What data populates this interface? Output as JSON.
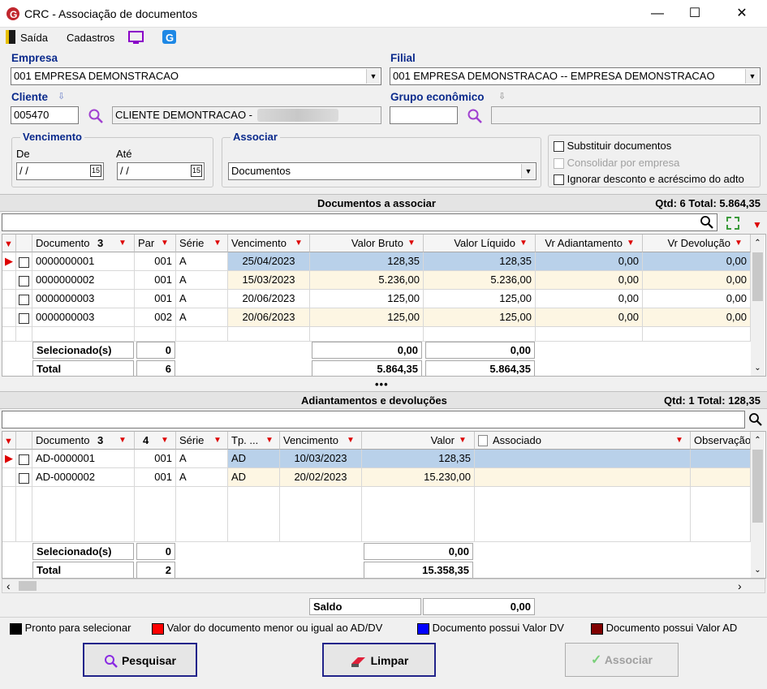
{
  "window": {
    "title": "CRC - Associação de documentos"
  },
  "menu": {
    "exit": "Saída",
    "cadastros": "Cadastros"
  },
  "form": {
    "empresa_label": "Empresa",
    "empresa_value": "001 EMPRESA DEMONSTRACAO",
    "filial_label": "Filial",
    "filial_value": "001 EMPRESA DEMONSTRACAO -- EMPRESA DEMONSTRACAO",
    "cliente_label": "Cliente",
    "cliente_code": "005470",
    "cliente_name": "CLIENTE DEMONTRACAO -",
    "grupo_label": "Grupo econômico",
    "vencimento_label": "Vencimento",
    "de_label": "De",
    "ate_label": "Até",
    "de_value": "/ /",
    "ate_value": "/ /",
    "associar_label": "Associar",
    "associar_value": "Documentos",
    "substituir": "Substituir documentos",
    "consolidar": "Consolidar por empresa",
    "ignorar": "Ignorar desconto e acréscimo do adto"
  },
  "docs": {
    "title": "Documentos a associar",
    "summary": "Qtd: 6 Total: 5.864,35",
    "columns": {
      "documento": "Documento",
      "par": "Par",
      "serie": "Série",
      "vencimento": "Vencimento",
      "valor_bruto": "Valor Bruto",
      "valor_liquido": "Valor Líquido",
      "vr_adiantamento": "Vr Adiantamento",
      "vr_devolucao": "Vr Devolução"
    },
    "sort_doc": "3",
    "rows": [
      {
        "documento": "0000000001",
        "par": "001",
        "serie": "A",
        "vencimento": "25/04/2023",
        "valor_bruto": "128,35",
        "valor_liquido": "128,35",
        "vr_adiantamento": "0,00",
        "vr_devolucao": "0,00"
      },
      {
        "documento": "0000000002",
        "par": "001",
        "serie": "A",
        "vencimento": "15/03/2023",
        "valor_bruto": "5.236,00",
        "valor_liquido": "5.236,00",
        "vr_adiantamento": "0,00",
        "vr_devolucao": "0,00"
      },
      {
        "documento": "0000000003",
        "par": "001",
        "serie": "A",
        "vencimento": "20/06/2023",
        "valor_bruto": "125,00",
        "valor_liquido": "125,00",
        "vr_adiantamento": "0,00",
        "vr_devolucao": "0,00"
      },
      {
        "documento": "0000000003",
        "par": "002",
        "serie": "A",
        "vencimento": "20/06/2023",
        "valor_bruto": "125,00",
        "valor_liquido": "125,00",
        "vr_adiantamento": "0,00",
        "vr_devolucao": "0,00"
      }
    ],
    "selecionados_label": "Selecionado(s)",
    "selecionados_qtd": "0",
    "selecionados_bruto": "0,00",
    "selecionados_liquido": "0,00",
    "total_label": "Total",
    "total_qtd": "6",
    "total_bruto": "5.864,35",
    "total_liquido": "5.864,35"
  },
  "adv": {
    "title": "Adiantamentos e devoluções",
    "summary": "Qtd: 1 Total: 128,35",
    "columns": {
      "documento": "Documento",
      "par": "",
      "serie": "Série",
      "tp": "Tp. ...",
      "vencimento": "Vencimento",
      "valor": "Valor",
      "associado": "Associado",
      "observacao": "Observação"
    },
    "sort_doc": "3",
    "sort_par": "4",
    "rows": [
      {
        "documento": "AD-0000001",
        "par": "001",
        "serie": "A",
        "tp": "AD",
        "vencimento": "10/03/2023",
        "valor": "128,35"
      },
      {
        "documento": "AD-0000002",
        "par": "001",
        "serie": "A",
        "tp": "AD",
        "vencimento": "20/02/2023",
        "valor": "15.230,00"
      }
    ],
    "selecionados_label": "Selecionado(s)",
    "selecionados_qtd": "0",
    "selecionados_valor": "0,00",
    "total_label": "Total",
    "total_qtd": "2",
    "total_valor": "15.358,35"
  },
  "saldo": {
    "label": "Saldo",
    "value": "0,00"
  },
  "legend": [
    {
      "color": "#000000",
      "label": "Pronto para selecionar"
    },
    {
      "color": "#ff0000",
      "label": "Valor do documento menor ou igual ao AD/DV"
    },
    {
      "color": "#0000ff",
      "label": "Documento possui Valor DV"
    },
    {
      "color": "#800000",
      "label": "Documento possui Valor AD"
    }
  ],
  "buttons": {
    "pesquisar": "Pesquisar",
    "limpar": "Limpar",
    "associar": "Associar"
  },
  "colors": {
    "label_blue": "#0a2a8c",
    "selected_row": "#b9d1ea",
    "alt_row": "#fdf6e3",
    "filter_red": "#dd0000"
  }
}
